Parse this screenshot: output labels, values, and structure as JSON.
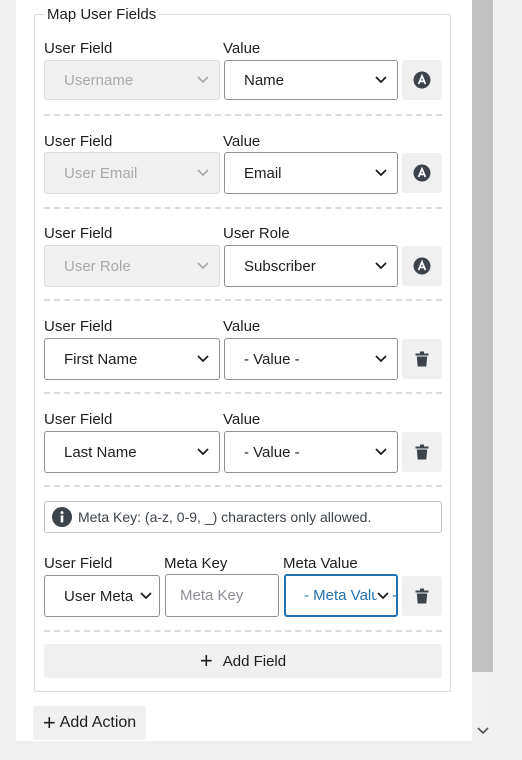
{
  "section": {
    "legend": "Map User Fields"
  },
  "rows": [
    {
      "left_label": "User Field",
      "right_label": "Value",
      "field": "Username",
      "value": "Name",
      "action_icon": "a-circle-icon"
    },
    {
      "left_label": "User Field",
      "right_label": "Value",
      "field": "User Email",
      "value": "Email",
      "action_icon": "a-circle-icon"
    },
    {
      "left_label": "User Field",
      "right_label": "User Role",
      "field": "User Role",
      "value": "Subscriber",
      "action_icon": "a-circle-icon"
    },
    {
      "left_label": "User Field",
      "right_label": "Value",
      "field": "First Name",
      "value": "- Value -",
      "action_icon": "trash-icon"
    },
    {
      "left_label": "User Field",
      "right_label": "Value",
      "field": "Last Name",
      "value": "- Value -",
      "action_icon": "trash-icon"
    }
  ],
  "notice": {
    "text": "Meta Key: (a-z, 0-9, _) characters only allowed.",
    "icon": "info-icon"
  },
  "meta_row": {
    "field_label": "User Field",
    "key_label": "Meta Key",
    "value_label": "Meta Value",
    "field": "User Meta",
    "key_placeholder": "Meta Key",
    "value": "- Meta Value -",
    "action_icon": "trash-icon"
  },
  "buttons": {
    "add_field": "Add Field",
    "add_action": "Add Action"
  },
  "colors": {
    "accent": "#2271b1",
    "button_bg": "#f0f0f1",
    "border": "#8c8f94"
  }
}
